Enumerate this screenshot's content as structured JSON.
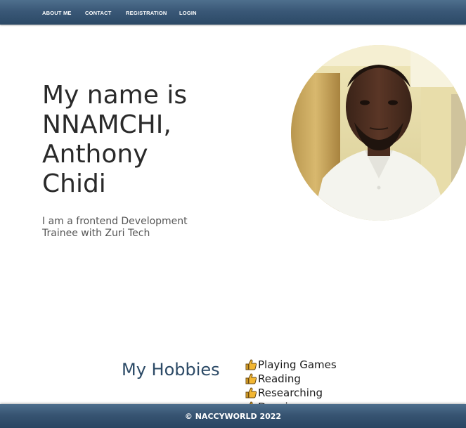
{
  "nav": {
    "items": [
      {
        "label": "ABOUT ME"
      },
      {
        "label": "CONTACT"
      },
      {
        "label": "REGISTRATION"
      },
      {
        "label": "LOGIN"
      }
    ]
  },
  "hero": {
    "title": "My name is NNAMCHI, Anthony Chidi",
    "subtitle": "I am a frontend Development Trainee with Zuri Tech"
  },
  "profile_photo": {
    "icon": "profile-photo"
  },
  "hobbies": {
    "title": "My Hobbies",
    "icon": "thumbs-up-icon",
    "items": [
      "Playing Games",
      "Reading",
      "Researching",
      "Dancing"
    ]
  },
  "footer": {
    "text": "© NACCYWORLD 2022"
  },
  "colors": {
    "nav_bg": "#3a5877",
    "hobbies_title": "#2c4a66",
    "thumb": "#f2b632"
  }
}
